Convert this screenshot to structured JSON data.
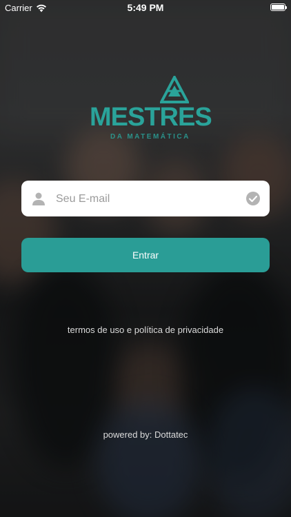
{
  "status_bar": {
    "carrier": "Carrier",
    "time": "5:49 PM"
  },
  "logo": {
    "title": "MESTRES",
    "subtitle": "DA MATEMÁTICA",
    "color": "#2aa39a"
  },
  "login": {
    "email_placeholder": "Seu E-mail",
    "email_value": "",
    "enter_label": "Entrar",
    "accent": "#2a9d96"
  },
  "footer": {
    "terms_label": "termos de uso e política de privacidade",
    "powered_by": "powered by: Dottatec"
  },
  "icons": {
    "field_left": "person-icon",
    "field_right": "checkmark-circle-icon",
    "wifi": "wifi-icon",
    "battery": "battery-icon"
  }
}
